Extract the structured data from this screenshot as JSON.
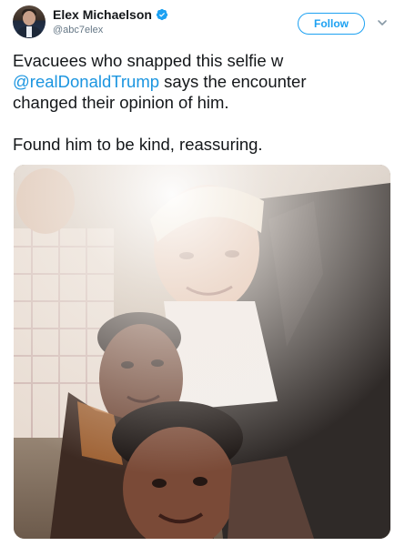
{
  "author": {
    "display_name": "Elex Michaelson",
    "handle": "@abc7elex",
    "verified": true
  },
  "actions": {
    "follow_label": "Follow",
    "caret_icon": "chevron-down-icon"
  },
  "tweet": {
    "line1": "Evacuees who snapped this selfie w",
    "mention": "@realDonaldTrump",
    "line2_rest": " says the encounter",
    "line3": "changed their opinion of him.",
    "paragraph2": "Found him to be kind, reassuring."
  },
  "colors": {
    "accent": "#1da1f2",
    "mention": "#1b95e0",
    "text": "#14171a",
    "secondary": "#657786"
  }
}
